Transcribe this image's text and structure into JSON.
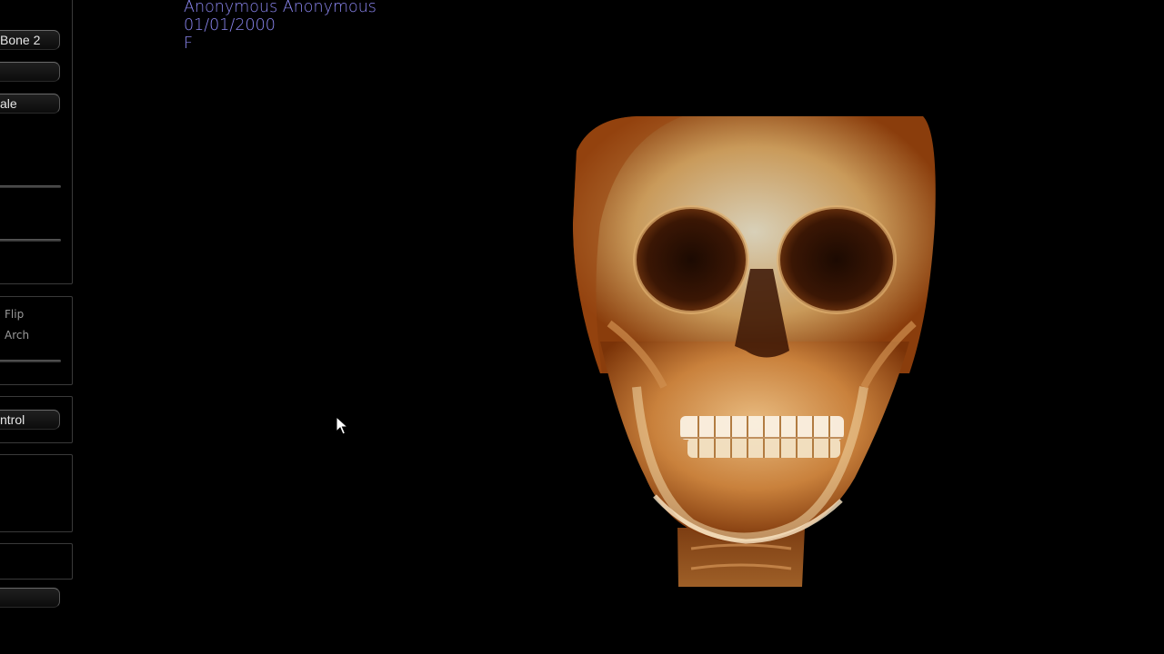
{
  "left_panel": {
    "preset_button_label": "Bone 2",
    "empty_button_label": "",
    "scale_button_label": "ale",
    "flip_option_label": "Flip",
    "arch_option_label": "Arch",
    "control_button_label": "ntrol",
    "bottom_button_label": ""
  },
  "patient_info": {
    "name": "Anonymous Anonymous",
    "dob": "01/01/2000",
    "sex": "F"
  },
  "viewport": {
    "render_preset": "bone volume render",
    "accent_color": "#8b86f0",
    "bone_color": "#d9a060"
  },
  "icons": {
    "cursor": "pointer-arrow-icon"
  }
}
